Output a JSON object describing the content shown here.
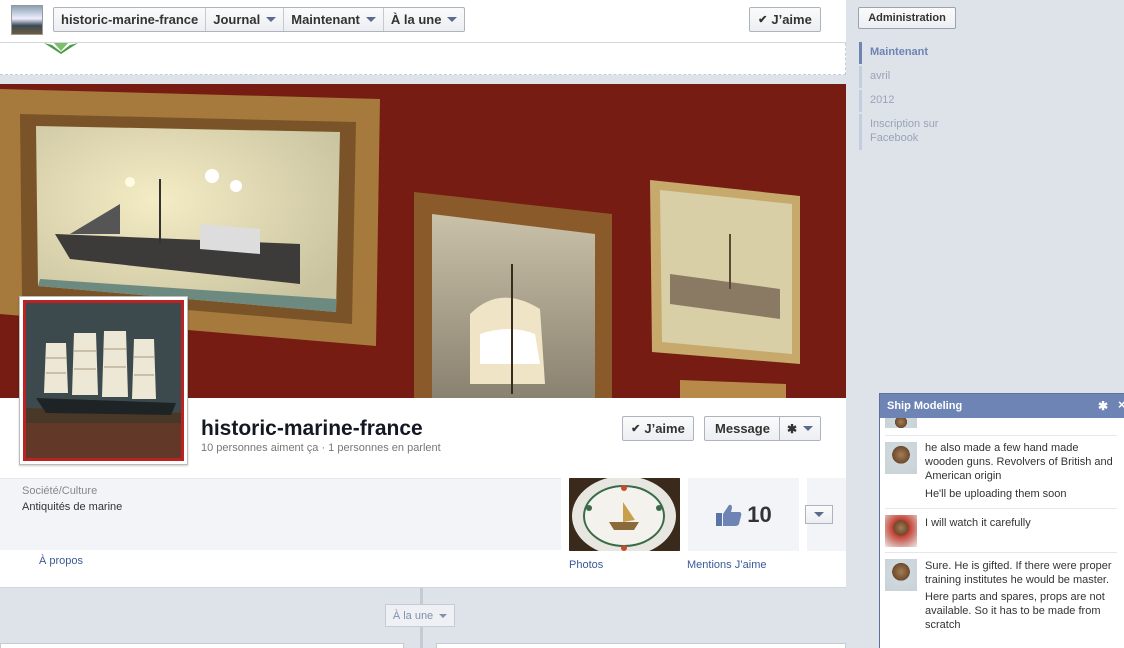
{
  "topbar": {
    "page_name": "historic-marine-france",
    "journal": "Journal",
    "maintenant": "Maintenant",
    "a_la_une": "À la une",
    "like": "J’aime"
  },
  "profile": {
    "name": "historic-marine-france",
    "stats": "10 personnes aiment ça · 1 personnes en parlent",
    "like_button": "J’aime",
    "message_button": "Message"
  },
  "info": {
    "category": "Société/Culture",
    "subcategory": "Antiquités de marine",
    "apropos": "À propos",
    "photos": "Photos",
    "likes_count": "10",
    "mentions": "Mentions J’aime"
  },
  "timeline": {
    "a_la_une_button": "À la une"
  },
  "sidebar": {
    "admin_button": "Administration",
    "scrubber": [
      {
        "label": "Maintenant",
        "active": true
      },
      {
        "label": "avril",
        "active": false
      },
      {
        "label": "2012",
        "active": false
      },
      {
        "label": "Inscription sur Facebook",
        "active": false
      }
    ]
  },
  "chat": {
    "title": "Ship Modeling",
    "messages": [
      {
        "lines": [
          "he also made a few hand made wooden guns. Revolvers of British and American origin",
          "He'll be uploading them soon"
        ]
      },
      {
        "lines": [
          "I will watch it carefully"
        ]
      },
      {
        "lines": [
          "Sure. He is gifted. If there were proper training institutes he would be master.",
          "Here parts and spares, props are not available. So it has to be made from scratch"
        ]
      }
    ]
  },
  "colors": {
    "accent": "#6d84b4",
    "link": "#3b5998",
    "cover_red": "#8b2216"
  }
}
